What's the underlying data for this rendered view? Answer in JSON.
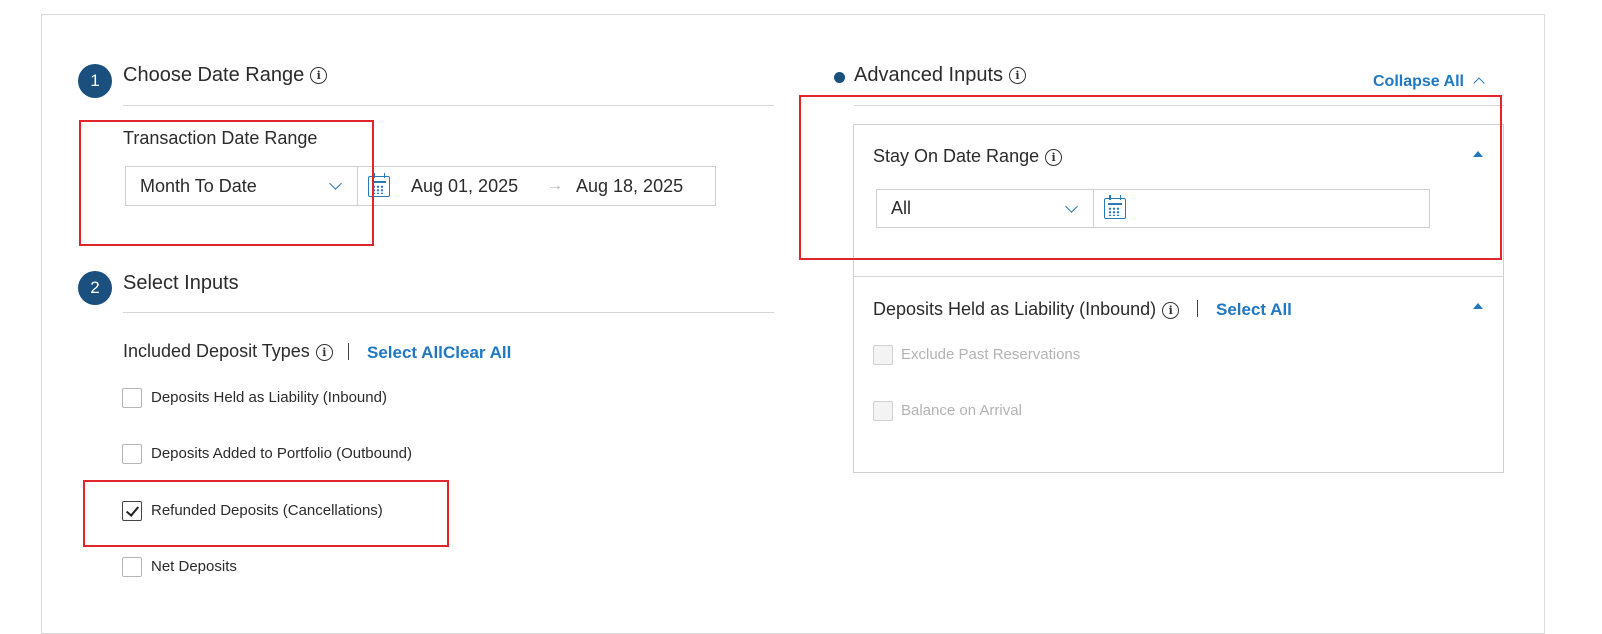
{
  "steps": [
    {
      "number": "1",
      "title": "Choose Date Range"
    },
    {
      "number": "2",
      "title": "Select Inputs"
    }
  ],
  "date_range": {
    "label": "Transaction Date Range",
    "preset": "Month To Date",
    "start": "Aug 01, 2025",
    "arrow": "→",
    "end": "Aug 18, 2025"
  },
  "deposit_types": {
    "label": "Included Deposit Types",
    "select_all": "Select All",
    "clear_all": "Clear All",
    "options": [
      {
        "label": "Deposits Held as Liability (Inbound)",
        "checked": false
      },
      {
        "label": "Deposits Added to Portfolio (Outbound)",
        "checked": false
      },
      {
        "label": "Refunded Deposits (Cancellations)",
        "checked": true
      },
      {
        "label": "Net Deposits",
        "checked": false
      }
    ]
  },
  "advanced": {
    "title": "Advanced Inputs",
    "collapse_all": "Collapse All",
    "stay_on": {
      "label": "Stay On Date Range",
      "preset": "All"
    },
    "liability": {
      "label": "Deposits Held as Liability (Inbound)",
      "select_all": "Select All",
      "options": [
        {
          "label": "Exclude Past Reservations",
          "checked": false,
          "disabled": true
        },
        {
          "label": "Balance on Arrival",
          "checked": false,
          "disabled": true
        }
      ]
    }
  },
  "colors": {
    "accent": "#1f78c1",
    "step_badge": "#1a4f7e",
    "highlight": "#e0262b"
  }
}
